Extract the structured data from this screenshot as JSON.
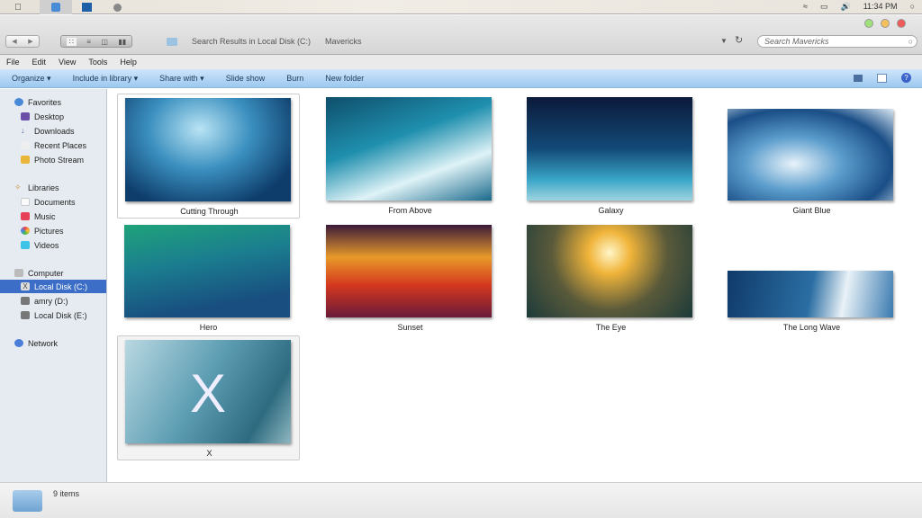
{
  "menubar": {
    "apps": [
      "apple-logo",
      "finder",
      "photoshop",
      "app"
    ],
    "time": "11:34 PM"
  },
  "window": {
    "breadcrumb": [
      "Search Results in Local Disk (C:)",
      "Mavericks"
    ],
    "search_placeholder": "Search Mavericks"
  },
  "menu": [
    "File",
    "Edit",
    "View",
    "Tools",
    "Help"
  ],
  "toolbar": {
    "organize": "Organize",
    "include": "Include in library",
    "share": "Share with",
    "slideshow": "Slide show",
    "burn": "Burn",
    "new_folder": "New folder"
  },
  "sidebar": {
    "favorites": "Favorites",
    "desktop": "Desktop",
    "downloads": "Downloads",
    "recent": "Recent Places",
    "photostream": "Photo Stream",
    "libraries": "Libraries",
    "documents": "Documents",
    "music": "Music",
    "pictures": "Pictures",
    "videos": "Videos",
    "computer": "Computer",
    "diskc": "Local Disk (C:)",
    "diskd": "amry (D:)",
    "diske": "Local Disk (E:)",
    "network": "Network"
  },
  "items": [
    {
      "name": "Cutting Through",
      "selected": true
    },
    {
      "name": "From Above"
    },
    {
      "name": "Galaxy"
    },
    {
      "name": "Giant Blue"
    },
    {
      "name": "Hero"
    },
    {
      "name": "Sunset"
    },
    {
      "name": "The Eye"
    },
    {
      "name": "The Long Wave"
    },
    {
      "name": "X",
      "hovered": true
    }
  ],
  "status": {
    "count": "9 items"
  }
}
